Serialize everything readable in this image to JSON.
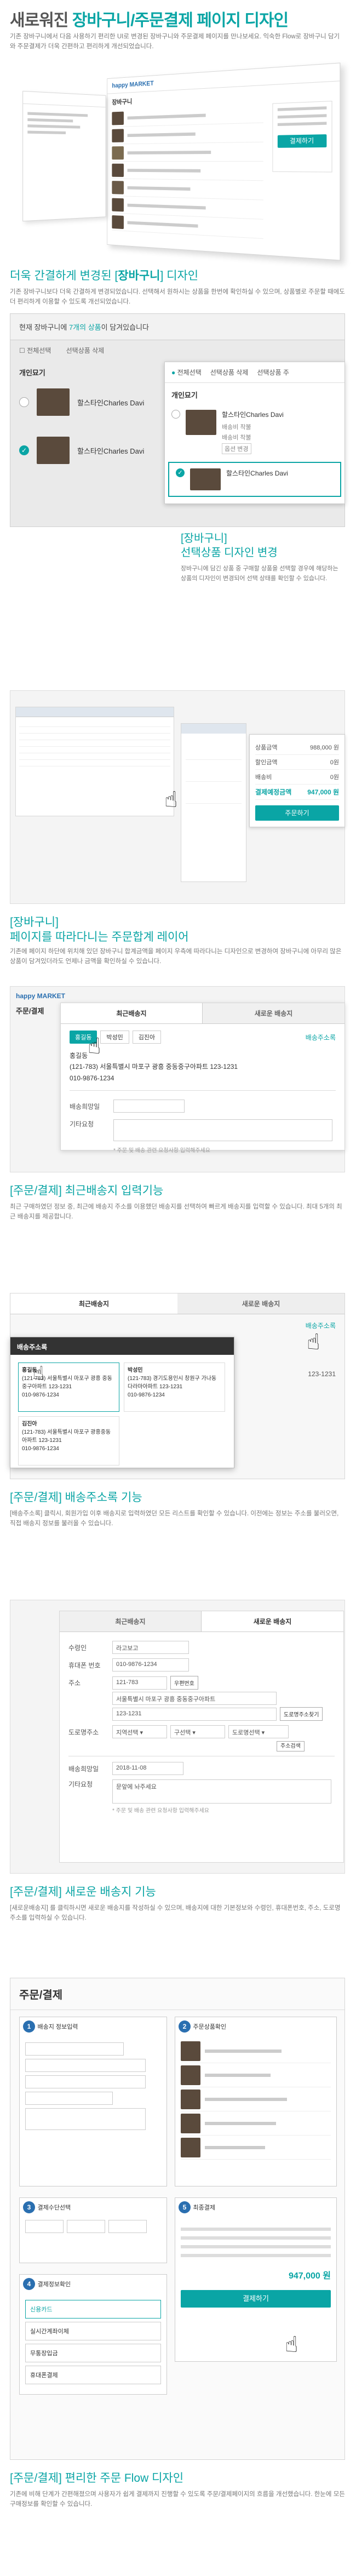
{
  "s1": {
    "title_pre": "새로워진 ",
    "title_accent": "장바구니/주문결제 페이지 디자인",
    "desc": "기존 장바구니에서 다음 사용하기 편리한 UI로 변경된 장바구니와 주문결제 페이지를 만나보세요. 익숙한 Flow로 장바구니 담기와 주문결제가 더욱 간편하고 편리하게 개선되었습니다.",
    "logo": "happy MARKET",
    "cart_title": "장바구니",
    "order_label": "결제하기"
  },
  "s2": {
    "heading_pre": "더욱 간결하게 변경된 [",
    "heading_accent": "장바구니",
    "heading_post": "] 디자인",
    "desc": "기존 장바구니보다 더욱 간결하게 변경되었습니다. 선택해서 원하시는 상품을 한번에 확인하실 수 있으며, 상품별로 주문할 때에도 더 편리하게 이용할 수 있도록 개선되었습니다.",
    "banner_pre": "현재 장바구니에 ",
    "banner_accent": "7개의 상품",
    "banner_post": "이 담겨있습니다",
    "select_all": "전체선택",
    "delete_sel": "선택상품 삭제",
    "select_sold": "선택상품 주",
    "group_label": "개인묘기",
    "item_name": "할스타인Charles Davi",
    "ship_label": "배송비",
    "ship_val": "착불",
    "qty_label": "배송비 착불",
    "opt_label": "옵션 변경",
    "zoom_heading1": "[장바구니]",
    "zoom_heading2": "선택상품 디자인 변경",
    "zoom_desc": "장바구니에 담긴 상품 중 구매할 상품을 선택할 경우에 해당하는 상품의 디자인이 변경되어 선택 상태를 확인할 수 있습니다."
  },
  "s3": {
    "summary_rows": [
      {
        "label": "상품금액",
        "value": "988,000 원"
      },
      {
        "label": "할인금액",
        "value": "0원"
      },
      {
        "label": "배송비",
        "value": "0원"
      },
      {
        "label": "결제예정금액",
        "value": "947,000 원"
      }
    ],
    "pay_button": "주문하기",
    "heading1": "[장바구니]",
    "heading2": "페이지를 따라다니는 주문합계 레이어",
    "desc": "기존에 페이지 하단에 위치해 있던 장바구니 합계금액을 페이지 우측에 따라다니는 디자인으로 변경하여 장바구니에 아무리 많은 상품이 담겨있더라도 언제나 금액을 확인하실 수 있습니다."
  },
  "s4": {
    "page_title": "주문/결제",
    "tab_recent": "최근배송지",
    "tab_new": "새로운 배송지",
    "chip_home": "홍길동",
    "chip_park": "박성민",
    "chip_kim": "김진아",
    "addr_book": "배송주소록",
    "name": "홍길동",
    "address": "(121-783) 서울특별시 마포구 광흥 중동중구아파트 123-1231",
    "phone": "010-9876-1234",
    "date_label": "배송희망일",
    "memo_label": "기타요청",
    "note": "* 주문 및 배송 관련 요청사항 입력해주세요",
    "heading1": "[주문/결제] ",
    "heading2": "최근배송지 입력기능",
    "desc": "최근 구매하였던 정보 중, 최근에 배송지 주소를 이용했던 배송지를 선택하여 빠르게 배송지를 입력할 수 있습니다. 최대 5개의 최근 배송지를 제공합니다."
  },
  "s5": {
    "tab_recent": "최근배송지",
    "tab_new": "새로운 배송지",
    "book_title": "배송주소록",
    "book_link": "배송주소록",
    "entries": [
      {
        "name": "홍길동",
        "addr": "(121-783) 서울특별시 마포구 광흥 중동중구아파트 123-1231",
        "phone": "010-9876-1234"
      },
      {
        "name": "박성민",
        "addr": "(121-783) 경기도용인시 창원구 가나동 다라마아파트 123-1231",
        "phone": "010-9876-1234"
      },
      {
        "name": "김진아",
        "addr": "(121-783) 서울특별시 마포구 광흥중동 아파트 123-1231",
        "phone": "010-9876-1234"
      }
    ],
    "cut_text": "123-1231",
    "heading1": "[주문/결제] ",
    "heading2": "배송주소록 기능",
    "desc": "[배송주소록] 클릭시, 회원가입 이후 배송지로 입력하였던 모든 리스트를 확인할 수 있습니다. 이전에는 정보는 주소를 불러오면, 직접 배송지 정보를 불러올 수 있습니다."
  },
  "s6": {
    "tab_recent": "최근배송지",
    "tab_new": "새로운 배송지",
    "f_name": "수령인",
    "v_name": "라고보고",
    "f_phone": "휴대폰 번호",
    "v_phone": "010-9876-1234",
    "f_addr": "주소",
    "v_zip": "121-783",
    "zip_btn": "우편번호",
    "v_addr1": "서울특별시 마포구 광흥 중동중구아파트",
    "v_addr2": "123-1231",
    "addr_btn": "도로명주소찾기",
    "f_road": "도로명주소",
    "sel_city": "지역선택",
    "sel_gu": "구선택",
    "sel_road": "도로명선택",
    "road_btn": "주소검색",
    "f_date": "배송희망일",
    "v_date": "2018-11-08",
    "f_memo": "기타요청",
    "v_memo": "문앞에 놔주세요",
    "note": "* 주문 및 배송 관련 요청사항 입력해주세요",
    "heading1": "[주문/결제] ",
    "heading2": "새로운 배송지 기능",
    "desc": "[새로운배송지] 를 클릭하시면 새로운 배송지를 작성하실 수 있으며, 배송지에 대한 기본정보와 수령인, 휴대폰번호, 주소, 도로명 주소를 입력하실 수 있습니다."
  },
  "s7": {
    "page_title": "주문/결제",
    "steps": [
      "배송지 정보입력",
      "주문상품확인",
      "결제수단선택",
      "결제정보확인",
      "최종결제"
    ],
    "pay_methods": [
      "신용카드",
      "실시간계좌이체",
      "무통장입금",
      "휴대폰결제"
    ],
    "total": "947,000",
    "won": "원",
    "pay_button": "결제하기",
    "heading1": "[주문/결제] ",
    "heading2": "편리한 주문 Flow 디자인",
    "desc": "기존에 비해 단계가 간편해졌으며 사용자가 쉽게 결제까지 진행할 수 있도록 주문/결제페이지의 흐름을 개선했습니다. 한눈에 모든 구매정보를 확인할 수 있습니다."
  },
  "colors": {
    "accent": "#0aa5a5",
    "dark": "#333333",
    "line": "#dddddd"
  }
}
